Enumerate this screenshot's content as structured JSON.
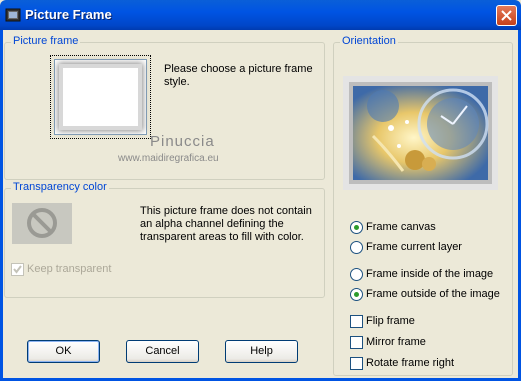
{
  "window": {
    "title": "Picture Frame"
  },
  "picture_frame": {
    "legend": "Picture frame",
    "instruction": "Please choose a picture frame style."
  },
  "watermark": {
    "name": "Pinuccia",
    "url": "www.maidiregrafica.eu"
  },
  "transparency": {
    "legend": "Transparency color",
    "description": "This picture frame does not contain an alpha channel defining the transparent areas to fill with color.",
    "keep_transparent_label": "Keep transparent",
    "keep_transparent_checked": true,
    "keep_transparent_enabled": false
  },
  "orientation": {
    "legend": "Orientation",
    "options": [
      {
        "label": "Frame canvas",
        "selected": true
      },
      {
        "label": "Frame current layer",
        "selected": false
      },
      {
        "label": "Frame inside of the image",
        "selected": false
      },
      {
        "label": "Frame outside of the image",
        "selected": true
      }
    ],
    "checkboxes": [
      {
        "label": "Flip frame",
        "checked": false
      },
      {
        "label": "Mirror frame",
        "checked": false
      },
      {
        "label": "Rotate frame right",
        "checked": false
      }
    ]
  },
  "buttons": {
    "ok": "OK",
    "cancel": "Cancel",
    "help": "Help"
  },
  "colors": {
    "titlebar": "#0054e3",
    "group_legend": "#0046d5",
    "dialog_bg": "#ece9d8",
    "radio_dot": "#2c9b2c"
  },
  "icons": {
    "app": "picture-frame-app-icon",
    "close": "close-icon",
    "no_transparency": "prohibited-icon",
    "check": "checkmark-icon"
  }
}
